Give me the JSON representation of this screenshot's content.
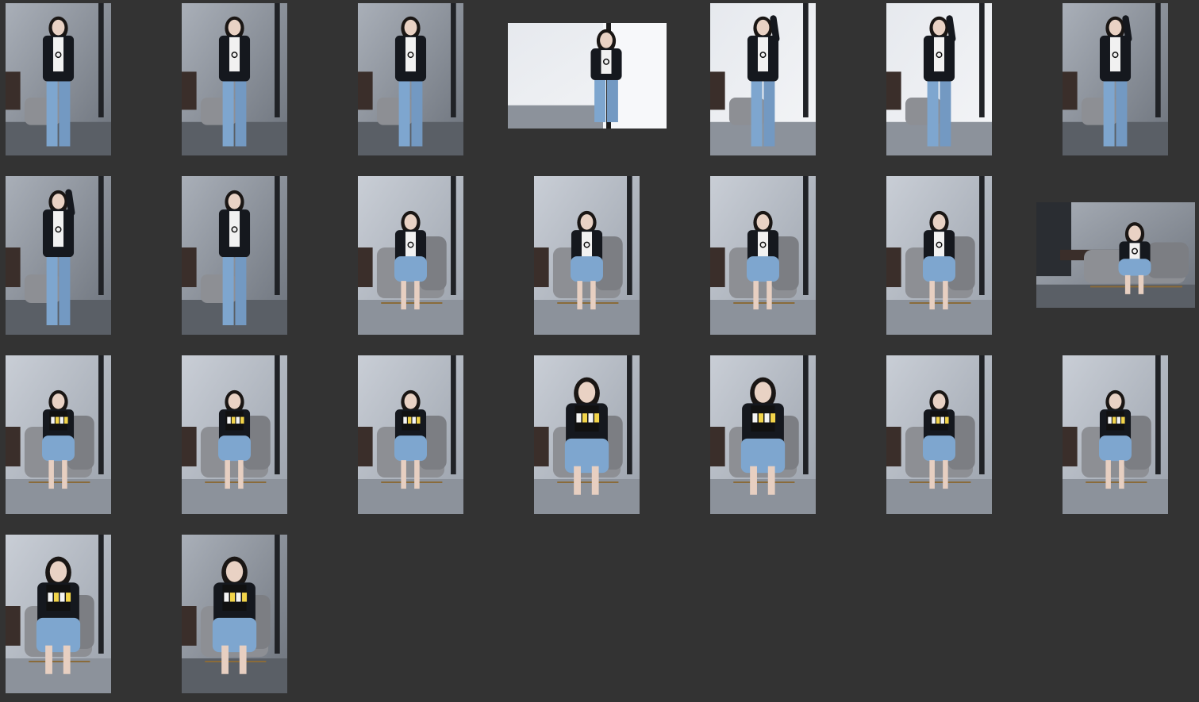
{
  "background": "#333333",
  "thumbnails": [
    {
      "index": 1,
      "orientation": "portrait",
      "pose": "standing",
      "scene": "dim"
    },
    {
      "index": 2,
      "orientation": "portrait",
      "pose": "standing",
      "scene": "dim"
    },
    {
      "index": 3,
      "orientation": "portrait",
      "pose": "standing",
      "scene": "dim"
    },
    {
      "index": 4,
      "orientation": "landscape",
      "pose": "standing-window",
      "scene": "bright"
    },
    {
      "index": 5,
      "orientation": "portrait",
      "pose": "leaning",
      "scene": "bright"
    },
    {
      "index": 6,
      "orientation": "portrait",
      "pose": "leaning",
      "scene": "bright"
    },
    {
      "index": 7,
      "orientation": "portrait",
      "pose": "leaning",
      "scene": "dim"
    },
    {
      "index": 8,
      "orientation": "portrait",
      "pose": "leaning",
      "scene": "dim"
    },
    {
      "index": 9,
      "orientation": "portrait",
      "pose": "standing",
      "scene": "dim"
    },
    {
      "index": 10,
      "orientation": "portrait",
      "pose": "seated",
      "scene": "light"
    },
    {
      "index": 11,
      "orientation": "portrait",
      "pose": "seated",
      "scene": "light"
    },
    {
      "index": 12,
      "orientation": "portrait",
      "pose": "seated",
      "scene": "light"
    },
    {
      "index": 13,
      "orientation": "portrait",
      "pose": "seated",
      "scene": "light"
    },
    {
      "index": 14,
      "orientation": "landscape",
      "pose": "seated",
      "scene": "dim"
    },
    {
      "index": 15,
      "orientation": "portrait",
      "pose": "seated-book",
      "scene": "light"
    },
    {
      "index": 16,
      "orientation": "portrait",
      "pose": "seated-book",
      "scene": "light"
    },
    {
      "index": 17,
      "orientation": "portrait",
      "pose": "seated-book",
      "scene": "light"
    },
    {
      "index": 18,
      "orientation": "portrait",
      "pose": "closeup-book",
      "scene": "light"
    },
    {
      "index": 19,
      "orientation": "portrait",
      "pose": "closeup-book",
      "scene": "light"
    },
    {
      "index": 20,
      "orientation": "portrait",
      "pose": "seated-book",
      "scene": "light"
    },
    {
      "index": 21,
      "orientation": "portrait",
      "pose": "seated-book",
      "scene": "light"
    },
    {
      "index": 22,
      "orientation": "portrait",
      "pose": "closeup-book",
      "scene": "light"
    },
    {
      "index": 23,
      "orientation": "portrait",
      "pose": "closeup-book",
      "scene": "dim"
    }
  ]
}
